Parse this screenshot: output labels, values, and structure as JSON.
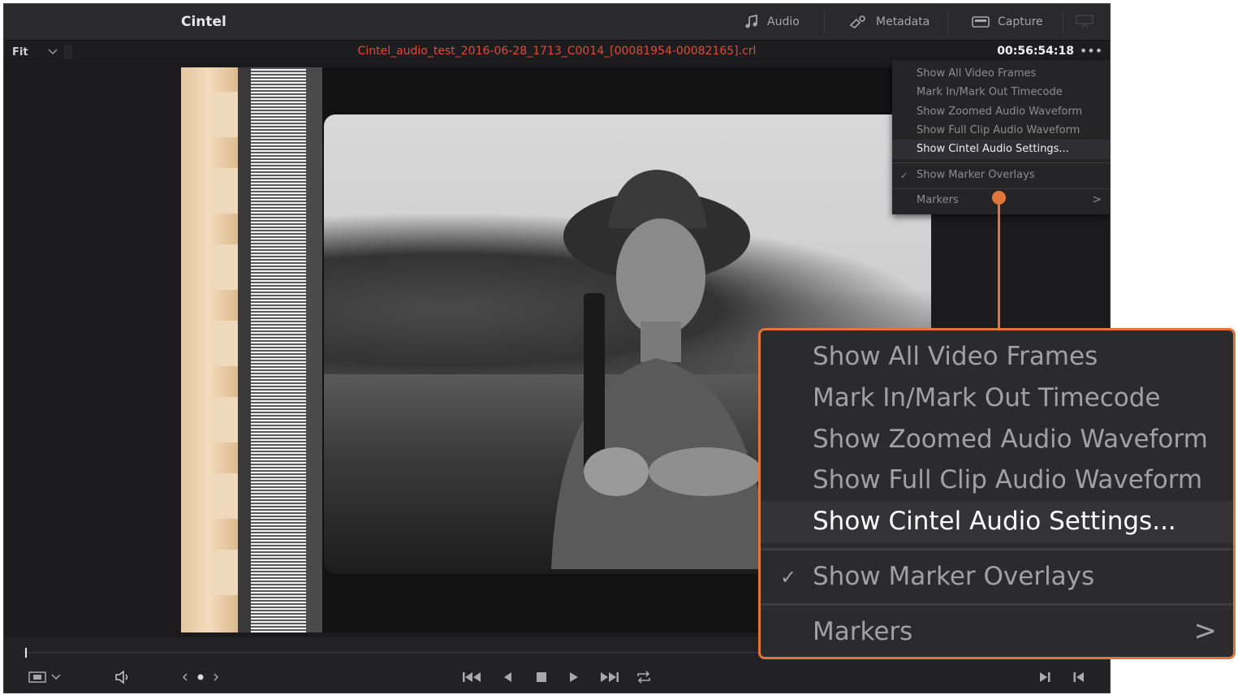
{
  "app": {
    "title": "Cintel",
    "toolbar": {
      "audio_label": "Audio",
      "metadata_label": "Metadata",
      "capture_label": "Capture"
    }
  },
  "subbar": {
    "zoom_value": "Fit",
    "filename": "Cintel_audio_test_2016-06-28_1713_C0014_[00081954-00082165].crl",
    "timecode": "00:56:54:18",
    "options_label": "•••"
  },
  "menu": {
    "items": [
      {
        "label": "Show All Video Frames"
      },
      {
        "label": "Mark In/Mark Out Timecode"
      },
      {
        "label": "Show Zoomed Audio Waveform"
      },
      {
        "label": "Show Full Clip Audio Waveform"
      },
      {
        "label": "Show Cintel Audio Settings..."
      },
      {
        "label": "Show Marker Overlays",
        "checked": true
      },
      {
        "label": "Markers",
        "submenu": true
      }
    ],
    "check_glyph": "✓",
    "submenu_glyph": ">"
  },
  "colors": {
    "accent": "#e0763b",
    "filename": "#e04a3a",
    "background": "#1e1e20"
  },
  "icons": [
    "music-note-icon",
    "metadata-icon",
    "capture-icon",
    "film-strip-icon",
    "volume-icon",
    "go-to-start-icon",
    "step-back-icon",
    "stop-icon",
    "play-icon",
    "go-to-end-icon",
    "loop-icon",
    "mark-out-icon",
    "mark-in-icon"
  ]
}
